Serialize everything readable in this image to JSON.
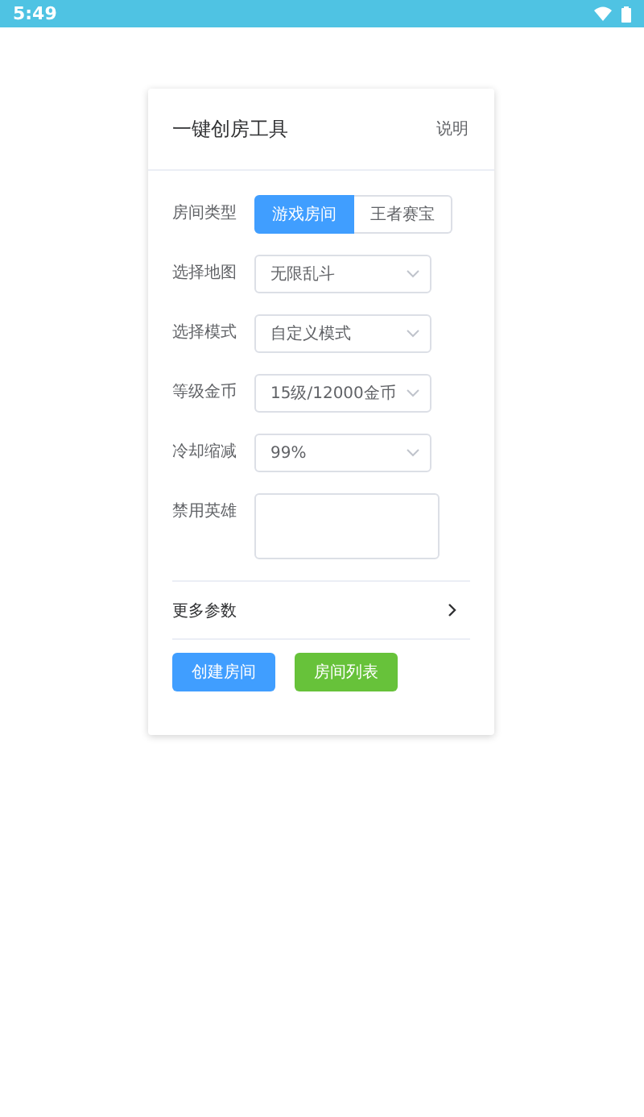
{
  "status_bar": {
    "time": "5:49"
  },
  "card": {
    "title": "一键创房工具",
    "help_link": "说明"
  },
  "form": {
    "rows": [
      {
        "kind": "segmented",
        "label": "房间类型",
        "options": [
          {
            "label": "游戏房间",
            "selected": true
          },
          {
            "label": "王者赛宝",
            "selected": false
          }
        ]
      },
      {
        "kind": "select",
        "label": "选择地图",
        "value": "无限乱斗"
      },
      {
        "kind": "select",
        "label": "选择模式",
        "value": "自定义模式"
      },
      {
        "kind": "select",
        "label": "等级金币",
        "value": "15级/12000金币"
      },
      {
        "kind": "select",
        "label": "冷却缩减",
        "value": "99%"
      },
      {
        "kind": "textarea",
        "label": "禁用英雄"
      }
    ]
  },
  "more": {
    "label": "更多参数"
  },
  "buttons": [
    {
      "label": "创建房间",
      "kind": "primary"
    },
    {
      "label": "房间列表",
      "kind": "success"
    }
  ]
}
